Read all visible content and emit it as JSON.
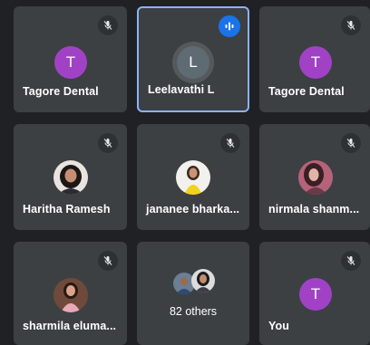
{
  "participants": [
    {
      "name": "Tagore Dental",
      "avatar_letter": "T",
      "muted": true
    },
    {
      "name": "Leelavathi L",
      "avatar_letter": "L",
      "speaking": true
    },
    {
      "name": "Tagore Dental",
      "avatar_letter": "T",
      "muted": true
    },
    {
      "name": "Haritha Ramesh",
      "muted": true
    },
    {
      "name": "jananee bharka...",
      "muted": true
    },
    {
      "name": "nirmala shanm...",
      "muted": true
    },
    {
      "name": "sharmila eluma...",
      "muted": true
    },
    {
      "others_label": "82 others"
    },
    {
      "name": "You",
      "avatar_letter": "T",
      "muted": true
    }
  ],
  "colors": {
    "background": "#202124",
    "tile": "#3c4043",
    "avatar_purple": "#a142c6",
    "active_border": "#8ab4f8",
    "speaking_badge": "#1a73e8"
  },
  "icons": {
    "muted": "mic-off-icon",
    "speaking": "audio-level-icon"
  }
}
